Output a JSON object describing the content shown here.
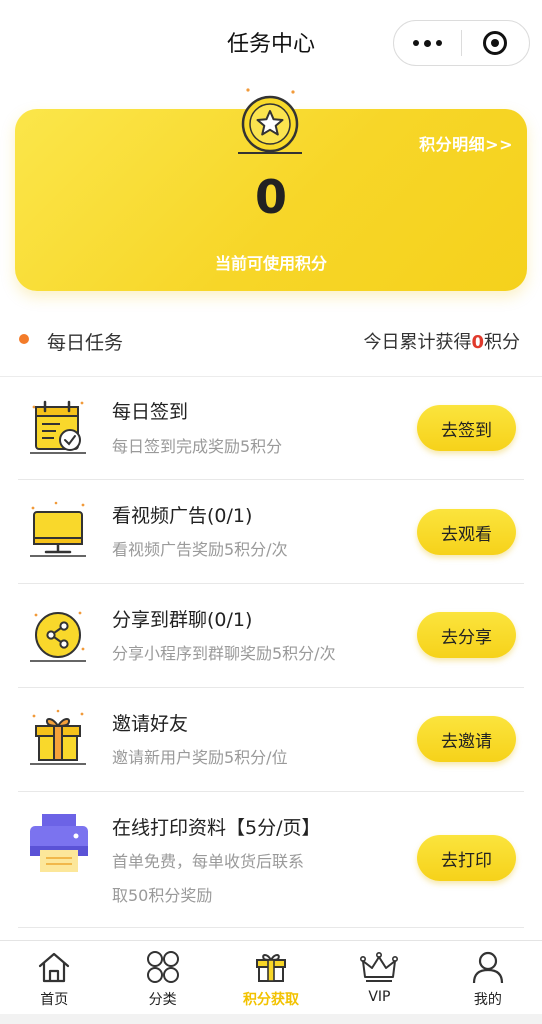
{
  "titlebar": {
    "title": "任务中心"
  },
  "card": {
    "detail_link": "积分明细>>",
    "points": "0",
    "points_label": "当前可使用积分"
  },
  "section": {
    "label": "每日任务",
    "today_prefix": "今日累计获得",
    "today_value": "0",
    "today_suffix": "积分"
  },
  "tasks": [
    {
      "icon": "calendar-check-icon",
      "name": "每日签到",
      "desc": "每日签到完成奖励5积分",
      "desc2": "",
      "button": "去签到"
    },
    {
      "icon": "monitor-icon",
      "name": "看视频广告(0/1)",
      "desc": "看视频广告奖励5积分/次",
      "desc2": "",
      "button": "去观看"
    },
    {
      "icon": "share-icon",
      "name": "分享到群聊(0/1)",
      "desc": "分享小程序到群聊奖励5积分/次",
      "desc2": "",
      "button": "去分享"
    },
    {
      "icon": "gift-icon",
      "name": "邀请好友",
      "desc": "邀请新用户奖励5积分/位",
      "desc2": "",
      "button": "去邀请"
    },
    {
      "icon": "printer-icon",
      "name": "在线打印资料【5分/页】",
      "desc": "首单免费，每单收货后联系",
      "desc2": "取50积分奖励",
      "button": "去打印"
    }
  ],
  "tabbar": {
    "items": [
      {
        "label": "首页",
        "icon": "home-icon"
      },
      {
        "label": "分类",
        "icon": "grid-circles-icon"
      },
      {
        "label": "积分获取",
        "icon": "gift-box-icon",
        "active": true
      },
      {
        "label": "VIP",
        "icon": "crown-icon"
      },
      {
        "label": "我的",
        "icon": "user-icon"
      }
    ]
  },
  "colors": {
    "accent": "#f7d628",
    "active_tab": "#f2c200",
    "highlight": "#e03a2c",
    "dot": "#f37b29"
  }
}
